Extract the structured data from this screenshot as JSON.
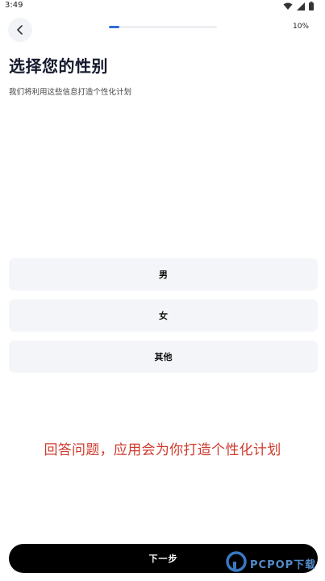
{
  "status_bar": {
    "time": "3:49",
    "icons": [
      "wifi-icon",
      "signal-icon",
      "battery-icon"
    ]
  },
  "header": {
    "back_icon": "chevron-left-icon",
    "progress_percent": 10,
    "progress_text": "10%"
  },
  "page": {
    "title": "选择您的性别",
    "subtitle": "我们将利用这些信息打造个性化计划"
  },
  "options": [
    {
      "label": "男"
    },
    {
      "label": "女"
    },
    {
      "label": "其他"
    }
  ],
  "promo_text": "回答问题，应用会为你打造个性化计划",
  "footer": {
    "next_label": "下一步"
  },
  "watermark": {
    "text": "PCPOP下载"
  },
  "colors": {
    "accent": "#2f6bd8",
    "promo_red": "#cf3a2d",
    "option_bg": "#f3f5f8",
    "button_bg": "#000000"
  }
}
